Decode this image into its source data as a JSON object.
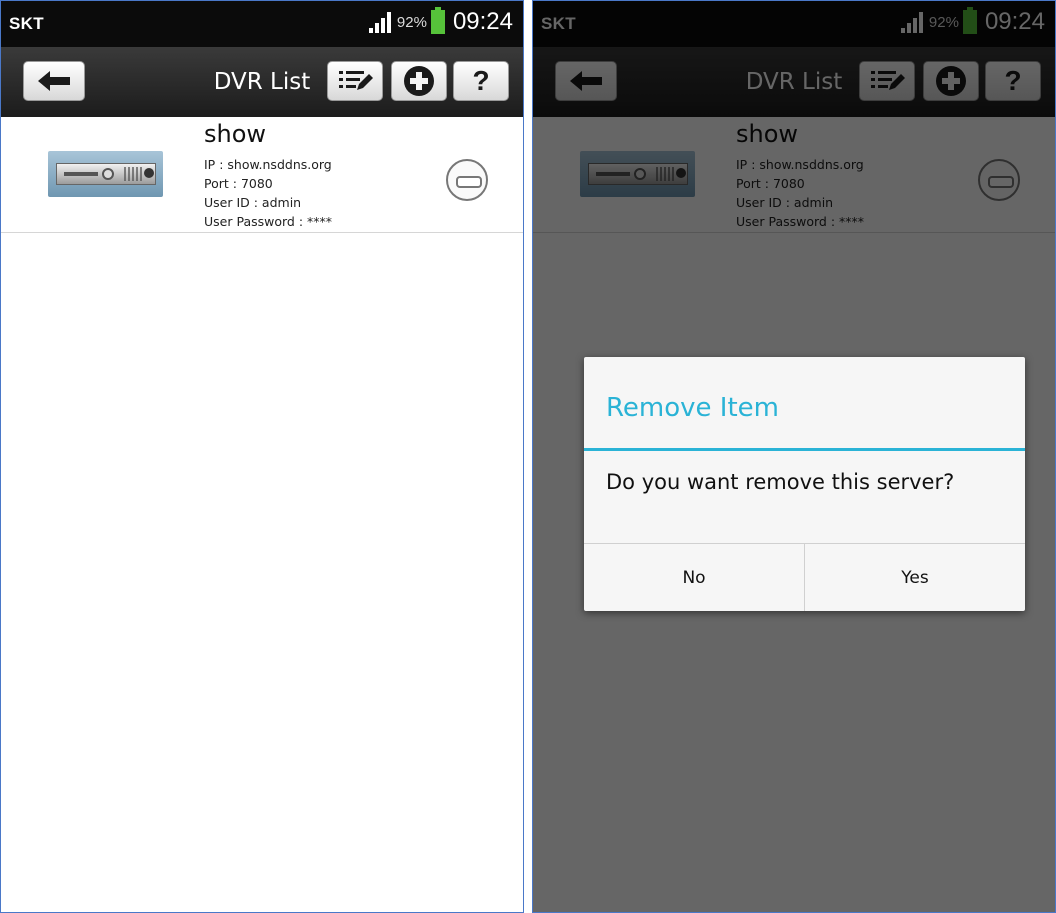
{
  "status_bar": {
    "carrier": "SKT",
    "battery_percent": "92%",
    "time": "09:24"
  },
  "action_bar": {
    "title": "DVR List",
    "help_label": "?"
  },
  "dvr_list": [
    {
      "name": "show",
      "ip": "IP : show.nsddns.org",
      "port": "Port : 7080",
      "user_id": "User ID : admin",
      "user_password": "User Password : ****"
    }
  ],
  "dialog": {
    "title": "Remove Item",
    "message": "Do you want remove this server?",
    "no_label": "No",
    "yes_label": "Yes"
  },
  "colors": {
    "dialog_accent": "#2ab3d6",
    "battery": "#56c23a"
  },
  "icons": [
    "signal-icon",
    "battery-icon",
    "back-arrow-icon",
    "edit-list-icon",
    "add-circle-icon",
    "help-icon",
    "dvr-device-icon",
    "remove-circle-icon"
  ]
}
